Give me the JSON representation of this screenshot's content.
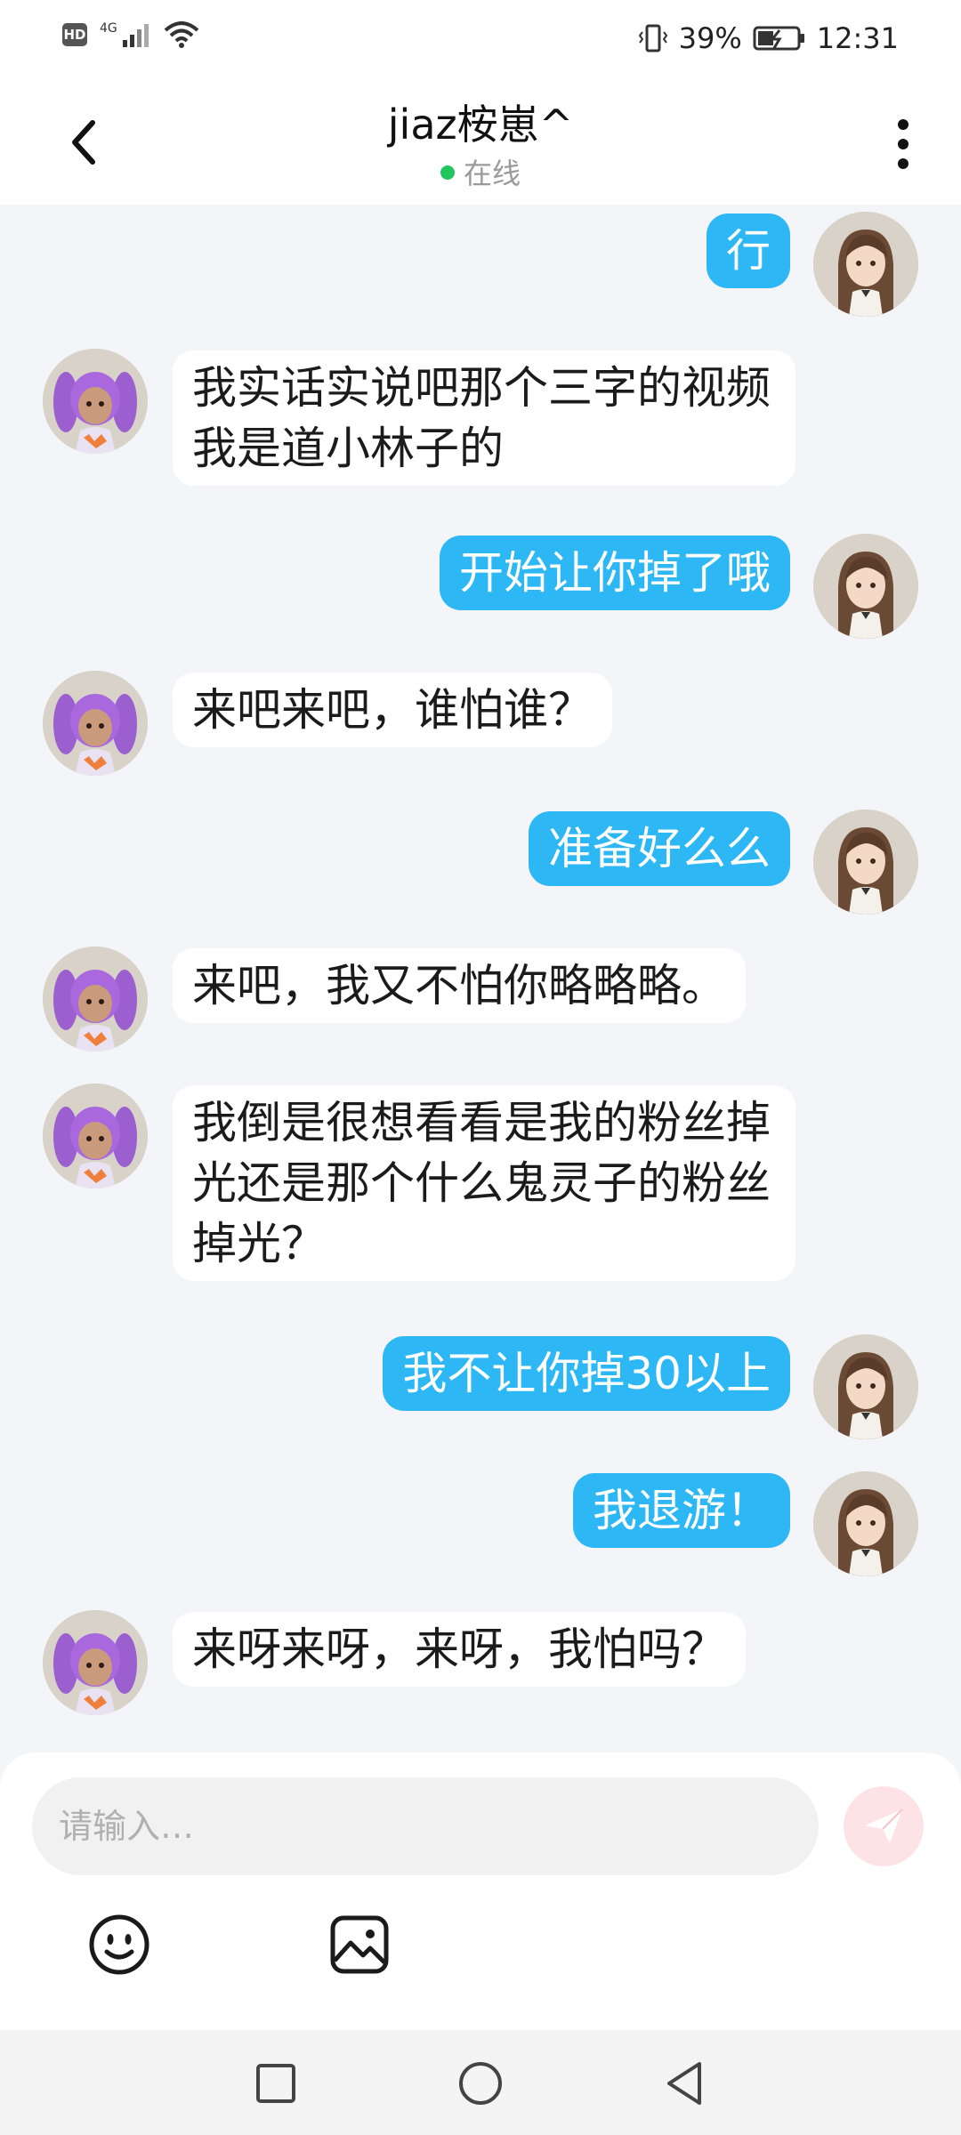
{
  "status_bar": {
    "hd": "HD",
    "network": "4G",
    "battery": "39%",
    "time": "12:31"
  },
  "header": {
    "title": "jiaz桉崽^",
    "status": "在线"
  },
  "messages": [
    {
      "side": "out",
      "text": "行"
    },
    {
      "side": "in",
      "text": "我实话实说吧那个三字的视频我是道小林子的"
    },
    {
      "side": "out",
      "text": "开始让你掉了哦"
    },
    {
      "side": "in",
      "text": "来吧来吧，谁怕谁？"
    },
    {
      "side": "out",
      "text": "准备好么么"
    },
    {
      "side": "in",
      "text": "来吧，我又不怕你略略略。"
    },
    {
      "side": "in",
      "text": "我倒是很想看看是我的粉丝掉光还是那个什么鬼灵子的粉丝掉光？"
    },
    {
      "side": "out",
      "text": "我不让你掉30以上"
    },
    {
      "side": "out",
      "text": "我退游！"
    },
    {
      "side": "in",
      "text": "来呀来呀，来呀，我怕吗？"
    }
  ],
  "input": {
    "placeholder": "请输入…"
  },
  "icons": {
    "back": "back-arrow-icon",
    "more": "more-vertical-icon",
    "send": "send-icon",
    "emoji": "emoji-icon",
    "image": "image-icon"
  },
  "colors": {
    "out_bubble": "#2db7f5",
    "in_bubble": "#ffffff",
    "online_dot": "#22c55e",
    "send_bg": "#fde3e6"
  }
}
